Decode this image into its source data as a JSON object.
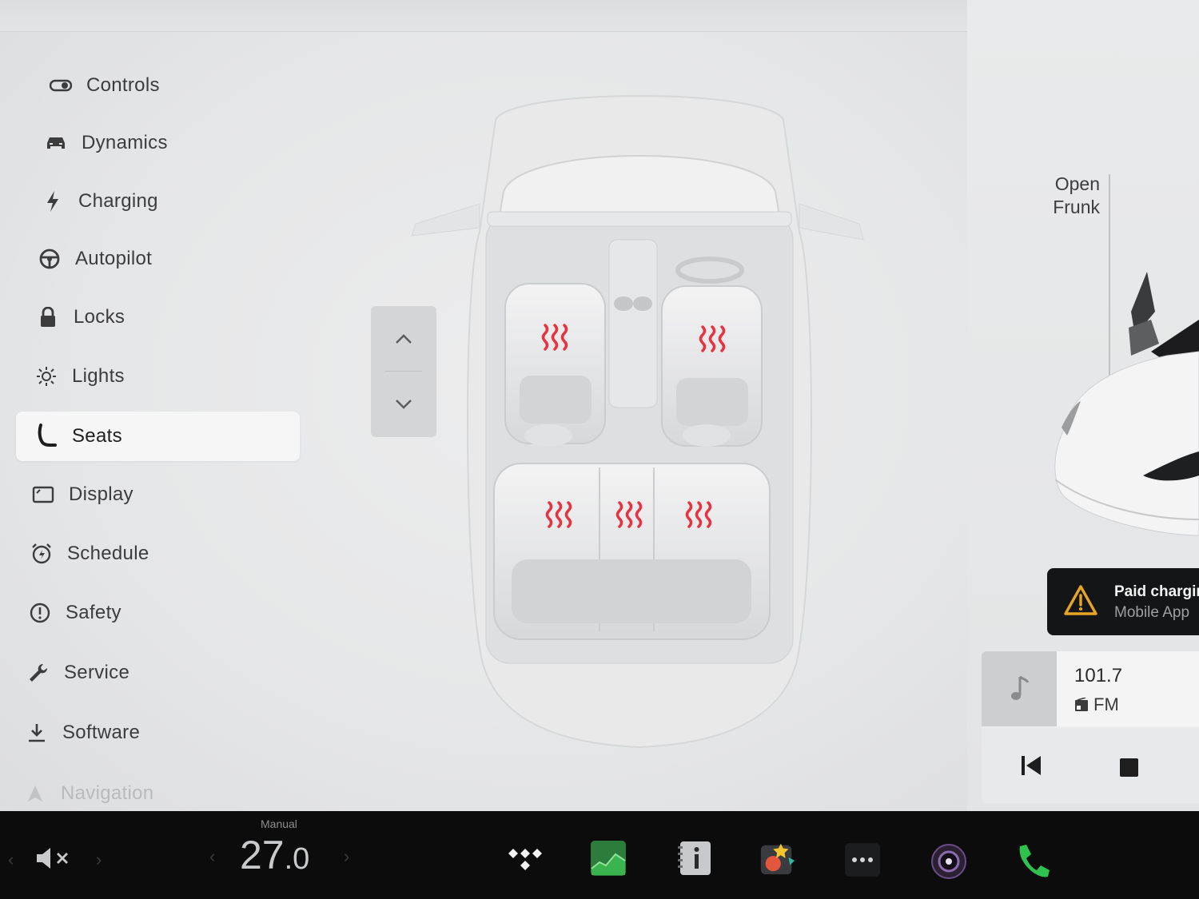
{
  "sidebar": {
    "items": [
      {
        "label": "Controls",
        "icon": "toggle-icon"
      },
      {
        "label": "Dynamics",
        "icon": "car-icon"
      },
      {
        "label": "Charging",
        "icon": "bolt-icon"
      },
      {
        "label": "Autopilot",
        "icon": "steering-wheel-icon"
      },
      {
        "label": "Locks",
        "icon": "lock-icon"
      },
      {
        "label": "Lights",
        "icon": "sun-icon"
      },
      {
        "label": "Seats",
        "icon": "seat-icon",
        "active": true
      },
      {
        "label": "Display",
        "icon": "display-icon"
      },
      {
        "label": "Schedule",
        "icon": "alarm-clock-icon"
      },
      {
        "label": "Safety",
        "icon": "alert-circle-icon"
      },
      {
        "label": "Service",
        "icon": "wrench-icon"
      },
      {
        "label": "Software",
        "icon": "download-icon"
      },
      {
        "label": "Navigation",
        "icon": "navigation-arrow-icon"
      }
    ]
  },
  "seat_heaters": {
    "color": "#e8323f",
    "seats": [
      "front-left",
      "front-right",
      "rear-left",
      "rear-center",
      "rear-right"
    ]
  },
  "frunk": {
    "line1": "Open",
    "line2": "Frunk"
  },
  "notification": {
    "title": "Paid chargin",
    "subtitle": "Mobile App",
    "icon": "warning-triangle-icon",
    "accent": "#e8a524"
  },
  "media": {
    "frequency": "101.7",
    "band": "FM",
    "icon": "music-note-icon"
  },
  "bottom_bar": {
    "climate_mode": "Manual",
    "temperature_whole": "27",
    "temperature_decimal": ".0",
    "volume_icon": "speaker-muted-icon",
    "apps": [
      "tidal-icon",
      "energy-graph-icon",
      "manual-info-icon",
      "toybox-icon",
      "more-dots-icon",
      "camera-icon",
      "phone-icon"
    ]
  }
}
